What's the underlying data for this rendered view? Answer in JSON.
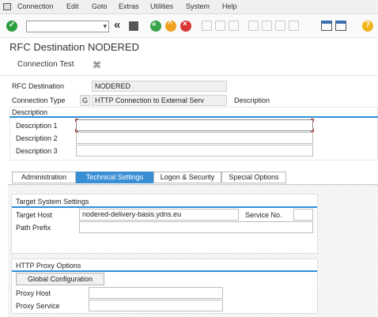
{
  "menu": {
    "items": [
      "Connection",
      "Edit",
      "Goto",
      "Extras",
      "Utilities",
      "System",
      "Help"
    ]
  },
  "toolbar": {
    "command_value": ""
  },
  "header": {
    "title": "RFC Destination NODERED"
  },
  "app_toolbar": {
    "connection_test": "Connection Test"
  },
  "form": {
    "rfc_destination_label": "RFC Destination",
    "rfc_destination_value": "NODERED",
    "connection_type_label": "Connection Type",
    "connection_type_code": "G",
    "connection_type_value": "HTTP Connection to External Serv",
    "description_label": "Description"
  },
  "description_section": {
    "title": "Description",
    "rows": [
      {
        "label": "Description 1",
        "value": ""
      },
      {
        "label": "Description 2",
        "value": ""
      },
      {
        "label": "Description 3",
        "value": ""
      }
    ]
  },
  "tabs": [
    "Administration",
    "Technical Settings",
    "Logon & Security",
    "Special Options"
  ],
  "target_system": {
    "title": "Target System Settings",
    "target_host_label": "Target Host",
    "target_host_value": "nodered-delivery-basis.ydns.eu",
    "service_no_label": "Service No.",
    "service_no_value": "",
    "path_prefix_label": "Path Prefix",
    "path_prefix_value": ""
  },
  "proxy": {
    "title": "HTTP Proxy Options",
    "global_config_button": "Global Configuration",
    "proxy_host_label": "Proxy Host",
    "proxy_host_value": "",
    "proxy_service_label": "Proxy Service",
    "proxy_service_value": ""
  }
}
